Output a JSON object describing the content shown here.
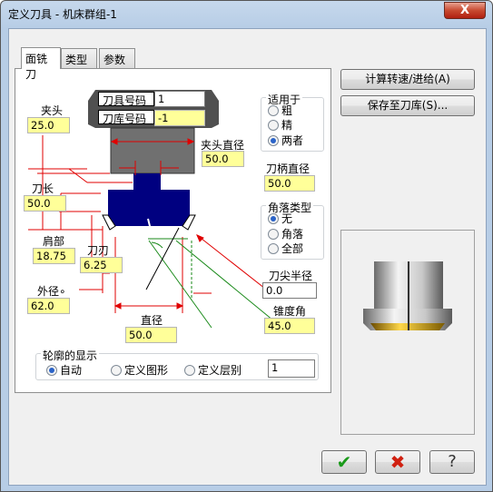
{
  "window": {
    "title": "定义刀具 - 机床群组-1",
    "close": "X"
  },
  "tabs": [
    "面铣刀",
    "类型",
    "参数"
  ],
  "holder": {
    "label": "夹头",
    "value": "25.0",
    "diam_label": "夹头直径",
    "diam_value": "50.0"
  },
  "tool_number": {
    "label": "刀具号码",
    "value": "1"
  },
  "lib_number": {
    "label": "刀库号码",
    "value": "-1"
  },
  "tool_length": {
    "label": "刀长",
    "value": "50.0"
  },
  "shoulder": {
    "label": "肩部",
    "value": "18.75"
  },
  "flute": {
    "label": "刀刃",
    "value": "6.25"
  },
  "outer_diam": {
    "label": "外径∘",
    "value": "62.0"
  },
  "diameter": {
    "label": "直径",
    "value": "50.0"
  },
  "shank_diam": {
    "label": "刀柄直径",
    "value": "50.0"
  },
  "tip_radius": {
    "label": "刀尖半径",
    "value": "0.0"
  },
  "taper": {
    "label": "锥度角",
    "value": "45.0"
  },
  "applies_to": {
    "title": "适用于",
    "options": [
      "粗",
      "精",
      "两者"
    ],
    "selected": 2
  },
  "corner_type": {
    "title": "角落类型",
    "options": [
      "无",
      "角落",
      "全部"
    ],
    "selected": 0
  },
  "profile": {
    "title": "轮廓的显示",
    "options": [
      "自动",
      "定义图形",
      "定义层别"
    ],
    "selected": 0,
    "value": "1"
  },
  "buttons": {
    "calc": "计算转速/进给(A)",
    "save": "保存至刀库(S)..."
  },
  "colors": {
    "yellow": "#ffff99",
    "red": "#e00000",
    "green": "#1a8a1a",
    "body": "#000080",
    "holder": "#707070"
  }
}
